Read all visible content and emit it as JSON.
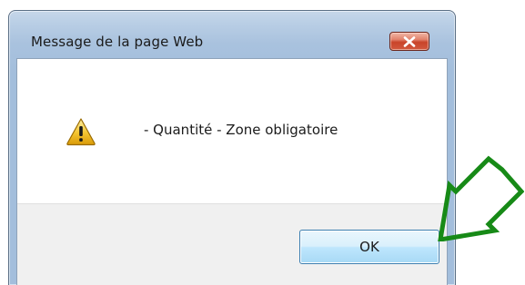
{
  "dialog": {
    "title": "Message de la page Web",
    "message": "- Quantité - Zone obligatoire",
    "ok_label": "OK",
    "close_icon": "close-icon",
    "message_icon": "warning-icon"
  },
  "annotation": {
    "icon": "arrow-annotation-icon",
    "color": "#178a17"
  },
  "colors": {
    "close_button": "#c9442a",
    "ok_button_border": "#3c7fb1",
    "warning_yellow": "#f4c430"
  }
}
